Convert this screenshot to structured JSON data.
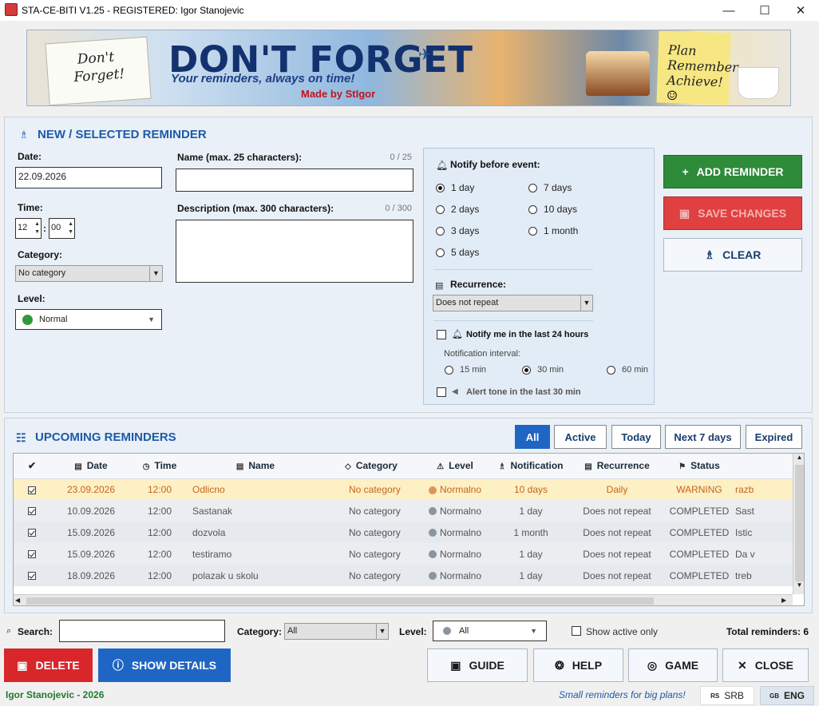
{
  "window": {
    "title": "STA-CE-BITI V1.25 - REGISTERED: Igor Stanojevic",
    "minimize": "—",
    "maximize": "☐",
    "close": "✕"
  },
  "banner": {
    "note_line1": "Don't",
    "note_line2": "Forget!",
    "headline": "DON'T FORGET",
    "tagline": "Your reminders, always on time!",
    "made_by": "Made by StIgor",
    "sticky1": "Plan",
    "sticky2": "Remember",
    "sticky3": "Achieve! ☺"
  },
  "form": {
    "header": "NEW / SELECTED REMINDER",
    "date_label": "Date:",
    "date_value": "22.09.2026",
    "time_label": "Time:",
    "hour": "12",
    "minute": "00",
    "time_sep": ":",
    "category_label": "Category:",
    "category_value": "No category",
    "level_label": "Level:",
    "level_value": "Normal",
    "name_label": "Name (max. 25 characters):",
    "name_count": "0 / 25",
    "desc_label": "Description (max. 300 characters):",
    "desc_count": "0 / 300"
  },
  "notify": {
    "label": "Notify before event:",
    "options": [
      {
        "label": "1 day",
        "selected": true
      },
      {
        "label": "7 days",
        "selected": false
      },
      {
        "label": "2 days",
        "selected": false
      },
      {
        "label": "10 days",
        "selected": false
      },
      {
        "label": "3 days",
        "selected": false
      },
      {
        "label": "1 month",
        "selected": false
      },
      {
        "label": "5 days",
        "selected": false
      }
    ],
    "recurrence_label": "Recurrence:",
    "recurrence_value": "Does not repeat",
    "last24_label": "Notify me in the last 24 hours",
    "interval_label": "Notification interval:",
    "intervals": [
      {
        "label": "15 min",
        "selected": false
      },
      {
        "label": "30 min",
        "selected": true
      },
      {
        "label": "60 min",
        "selected": false
      }
    ],
    "alert_label": "Alert tone in the last 30 min"
  },
  "actions": {
    "add": "ADD REMINDER",
    "save": "SAVE CHANGES",
    "clear": "CLEAR"
  },
  "list": {
    "header": "UPCOMING REMINDERS",
    "filters": [
      "All",
      "Active",
      "Today",
      "Next 7 days",
      "Expired"
    ],
    "columns": [
      "✔",
      "Date",
      "Time",
      "Name",
      "Category",
      "Level",
      "Notification",
      "Recurrence",
      "Status"
    ],
    "rows": [
      {
        "date": "23.09.2026",
        "time": "12:00",
        "name": "Odlicno",
        "category": "No category",
        "level": "Normalno",
        "notification": "10 days",
        "recurrence": "Daily",
        "status": "WARNING",
        "desc": "razb",
        "highlight": true
      },
      {
        "date": "10.09.2026",
        "time": "12:00",
        "name": "Sastanak",
        "category": "No category",
        "level": "Normalno",
        "notification": "1 day",
        "recurrence": "Does not repeat",
        "status": "COMPLETED",
        "desc": "Sast",
        "highlight": false
      },
      {
        "date": "15.09.2026",
        "time": "12:00",
        "name": "dozvola",
        "category": "No category",
        "level": "Normalno",
        "notification": "1 month",
        "recurrence": "Does not repeat",
        "status": "COMPLETED",
        "desc": "Istic",
        "highlight": false
      },
      {
        "date": "15.09.2026",
        "time": "12:00",
        "name": "testiramo",
        "category": "No category",
        "level": "Normalno",
        "notification": "1 day",
        "recurrence": "Does not repeat",
        "status": "COMPLETED",
        "desc": "Da v",
        "highlight": false
      },
      {
        "date": "18.09.2026",
        "time": "12:00",
        "name": "polazak u skolu",
        "category": "No category",
        "level": "Normalno",
        "notification": "1 day",
        "recurrence": "Does not repeat",
        "status": "COMPLETED",
        "desc": "treb",
        "highlight": false
      }
    ]
  },
  "searchbar": {
    "search_label": "Search:",
    "category_label": "Category:",
    "category_value": "All",
    "level_label": "Level:",
    "level_value": "All",
    "active_only": "Show active only",
    "total": "Total reminders: 6"
  },
  "bottom": {
    "delete": "DELETE",
    "details": "SHOW DETAILS",
    "guide": "GUIDE",
    "help": "HELP",
    "game": "GAME",
    "close": "CLOSE"
  },
  "status": {
    "author": "Igor Stanojevic - 2026",
    "slogan": "Small reminders for big plans!",
    "lang1_code": "RS",
    "lang1": "SRB",
    "lang2_code": "GB",
    "lang2": "ENG"
  },
  "colors": {
    "accent": "#1e5aa8",
    "add": "#2e8b3a",
    "save": "#d63a3a",
    "delete": "#d9262b",
    "details": "#1f66c4",
    "highlight_row": "#fdf0c4",
    "warning": "#c8641a"
  }
}
